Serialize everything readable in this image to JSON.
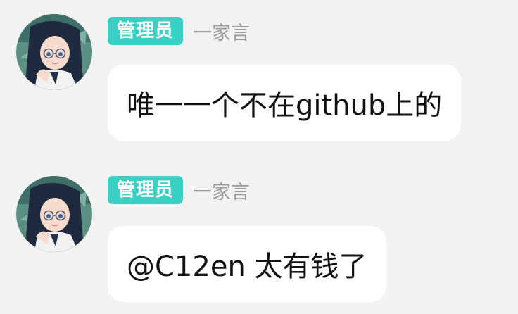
{
  "messages": [
    {
      "role": "管理员",
      "sender": "一家言",
      "text": "唯一一个不在github上的"
    },
    {
      "role": "管理员",
      "sender": "一家言",
      "text": "@C12en 太有钱了"
    }
  ],
  "colors": {
    "background": "#f2f2f2",
    "role_badge": "#3ad1c4",
    "sender_name": "#9a9a9a",
    "bubble": "#ffffff"
  },
  "icons": {
    "avatar": "anime-character-avatar"
  }
}
